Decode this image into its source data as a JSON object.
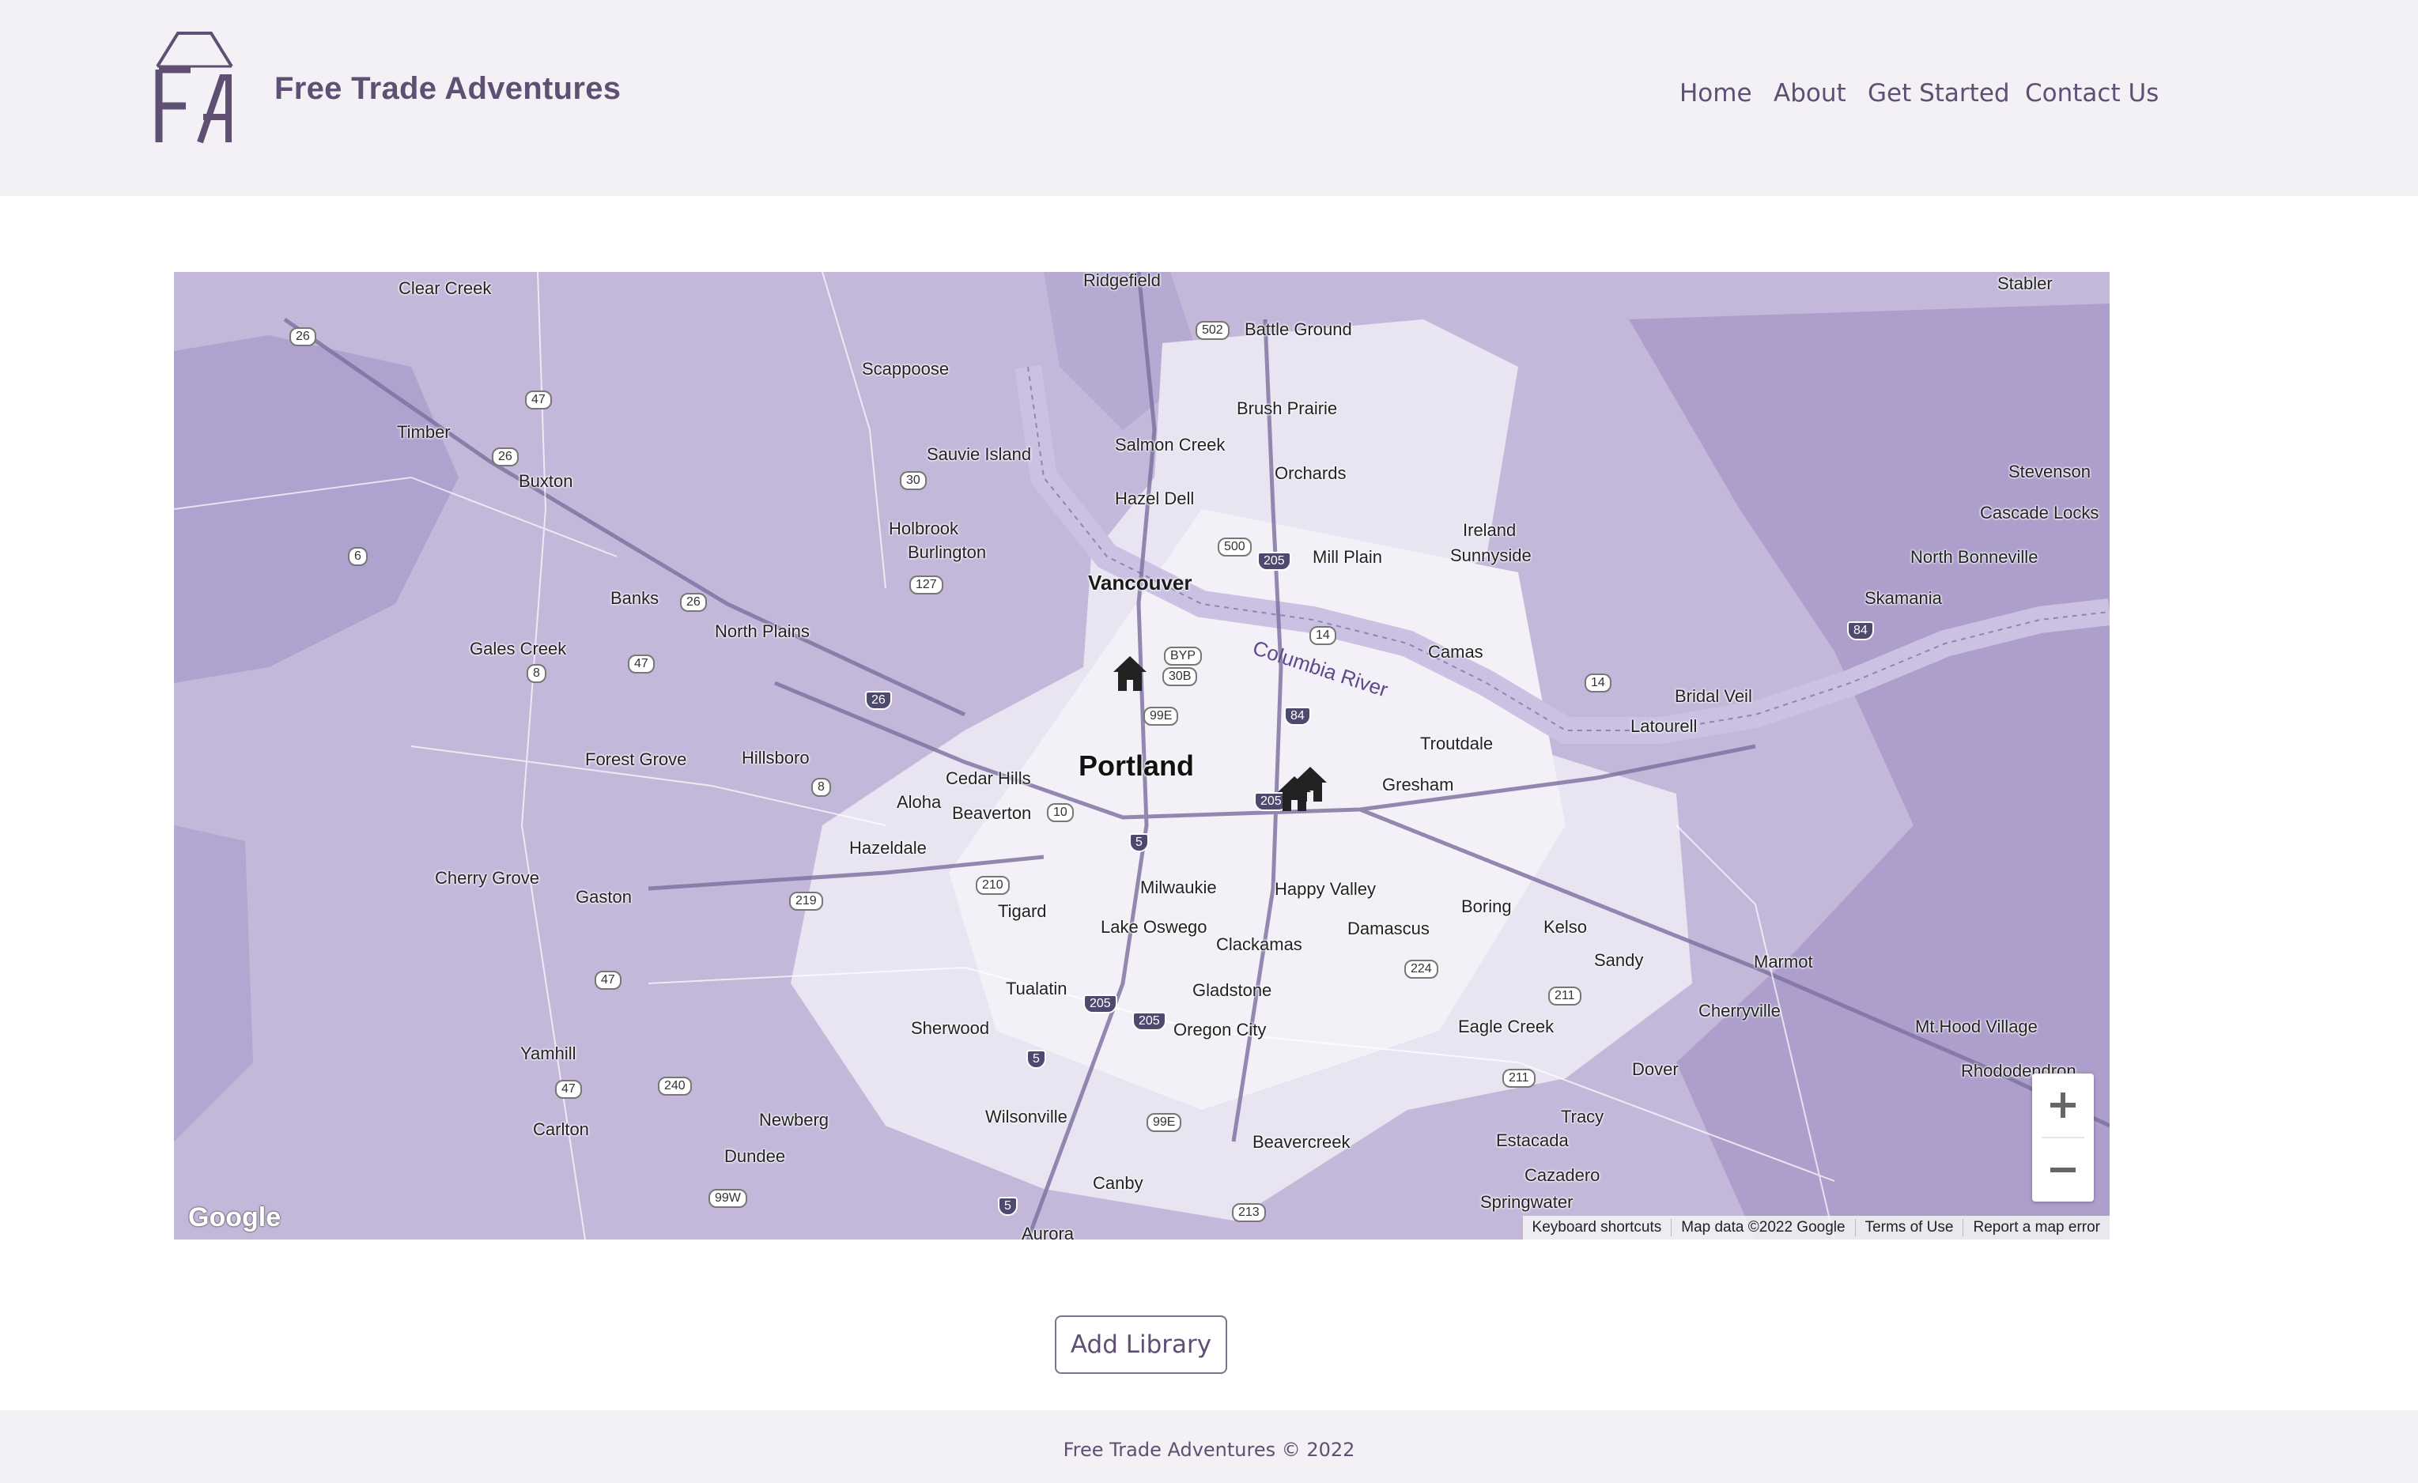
{
  "header": {
    "brand": "Free Trade Adventures",
    "nav": [
      "Home",
      "About",
      "Get Started",
      "Contact Us"
    ]
  },
  "map": {
    "city_label": "Portland",
    "labels": [
      "Clear Creek",
      "Timber",
      "Buxton",
      "Banks",
      "Gales Creek",
      "North Plains",
      "Forest Grove",
      "Hillsboro",
      "Cherry Grove",
      "Gaston",
      "Yamhill",
      "Carlton",
      "Newberg",
      "Dundee",
      "Scappoose",
      "Sauvie Island",
      "Holbrook",
      "Burlington",
      "Ridgefield",
      "Battle Ground",
      "Brush Prairie",
      "Salmon Creek",
      "Orchards",
      "Hazel Dell",
      "Mill Plain",
      "Ireland",
      "Sunnyside",
      "Camas",
      "Vancouver",
      "Cedar Hills",
      "Aloha",
      "Beaverton",
      "Hazeldale",
      "Tigard",
      "Milwaukie",
      "Happy Valley",
      "Lake Oswego",
      "Clackamas",
      "Damascus",
      "Tualatin",
      "Gladstone",
      "Sherwood",
      "Oregon City",
      "Wilsonville",
      "Canby",
      "Aurora",
      "Beavercreek",
      "Troutdale",
      "Gresham",
      "Boring",
      "Kelso",
      "Sandy",
      "Marmot",
      "Cherryville",
      "Eagle Creek",
      "Dover",
      "Tracy",
      "Estacada",
      "Cazadero",
      "Springwater",
      "Latourell",
      "Bridal Veil",
      "Skamania",
      "North Bonneville",
      "Stevenson",
      "Cascade Locks",
      "Stabler",
      "Mt.Hood Village",
      "Rhododendron"
    ],
    "river_label": "Columbia River",
    "shields": [
      "26",
      "47",
      "26",
      "6",
      "26",
      "47",
      "8",
      "26",
      "8",
      "219",
      "210",
      "10",
      "5",
      "47",
      "240",
      "47",
      "99W",
      "5",
      "99E",
      "5",
      "205",
      "205",
      "30",
      "127",
      "502",
      "500",
      "205",
      "14",
      "30B",
      "BYP",
      "99E",
      "84",
      "205",
      "14",
      "224",
      "211",
      "211",
      "213",
      "84"
    ],
    "zoom_in": "+",
    "zoom_out": "−",
    "google_logo": "Google",
    "attribution": [
      "Keyboard shortcuts",
      "Map data ©2022 Google",
      "Terms of Use",
      "Report a map error"
    ],
    "markers": [
      "house-marker",
      "house-marker",
      "house-marker"
    ]
  },
  "add_library_label": "Add Library",
  "footer": {
    "copyright": "Free Trade Adventures © 2022"
  },
  "colors": {
    "brand": "#5e4f73",
    "header_bg": "#f3f1f6",
    "map_base": "#c4b8da"
  }
}
